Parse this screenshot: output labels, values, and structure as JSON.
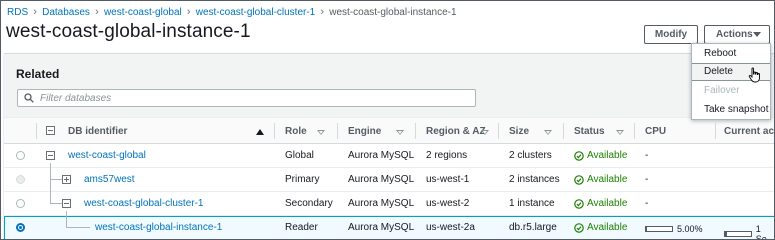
{
  "breadcrumb": [
    "RDS",
    "Databases",
    "west-coast-global",
    "west-coast-global-cluster-1",
    "west-coast-global-instance-1"
  ],
  "page_title": "west-coast-global-instance-1",
  "buttons": {
    "modify": "Modify",
    "actions": "Actions"
  },
  "actions_menu": [
    {
      "label": "Reboot",
      "state": "normal"
    },
    {
      "label": "Delete",
      "state": "hover"
    },
    {
      "label": "Failover",
      "state": "disabled"
    },
    {
      "label": "Take snapshot",
      "state": "normal"
    }
  ],
  "related": {
    "title": "Related",
    "search_placeholder": "Filter databases",
    "columns": [
      "DB identifier",
      "Role",
      "Engine",
      "Region & AZ",
      "Size",
      "Status",
      "CPU",
      "Current activity"
    ],
    "rows": [
      {
        "id": "west-coast-global",
        "role": "Global",
        "engine": "Aurora MySQL",
        "region": "2 regions",
        "size": "2 clusters",
        "status": "Available",
        "cpu": "-",
        "activity": ""
      },
      {
        "id": "ams57west",
        "role": "Primary",
        "engine": "Aurora MySQL",
        "region": "us-west-1",
        "size": "2 instances",
        "status": "Available",
        "cpu": "-",
        "activity": ""
      },
      {
        "id": "west-coast-global-cluster-1",
        "role": "Secondary",
        "engine": "Aurora MySQL",
        "region": "us-west-2",
        "size": "1 instance",
        "status": "Available",
        "cpu": "-",
        "activity": ""
      },
      {
        "id": "west-coast-global-instance-1",
        "role": "Reader",
        "engine": "Aurora MySQL",
        "region": "us-west-2a",
        "size": "db.r5.large",
        "status": "Available",
        "cpu": "5.00%",
        "cpu_fraction": 0.05,
        "activity": "1 Se"
      }
    ]
  },
  "colors": {
    "link": "#0073bb",
    "available": "#1d8102",
    "selected_border": "#00a1c9",
    "selected_bg": "#f1faff"
  }
}
